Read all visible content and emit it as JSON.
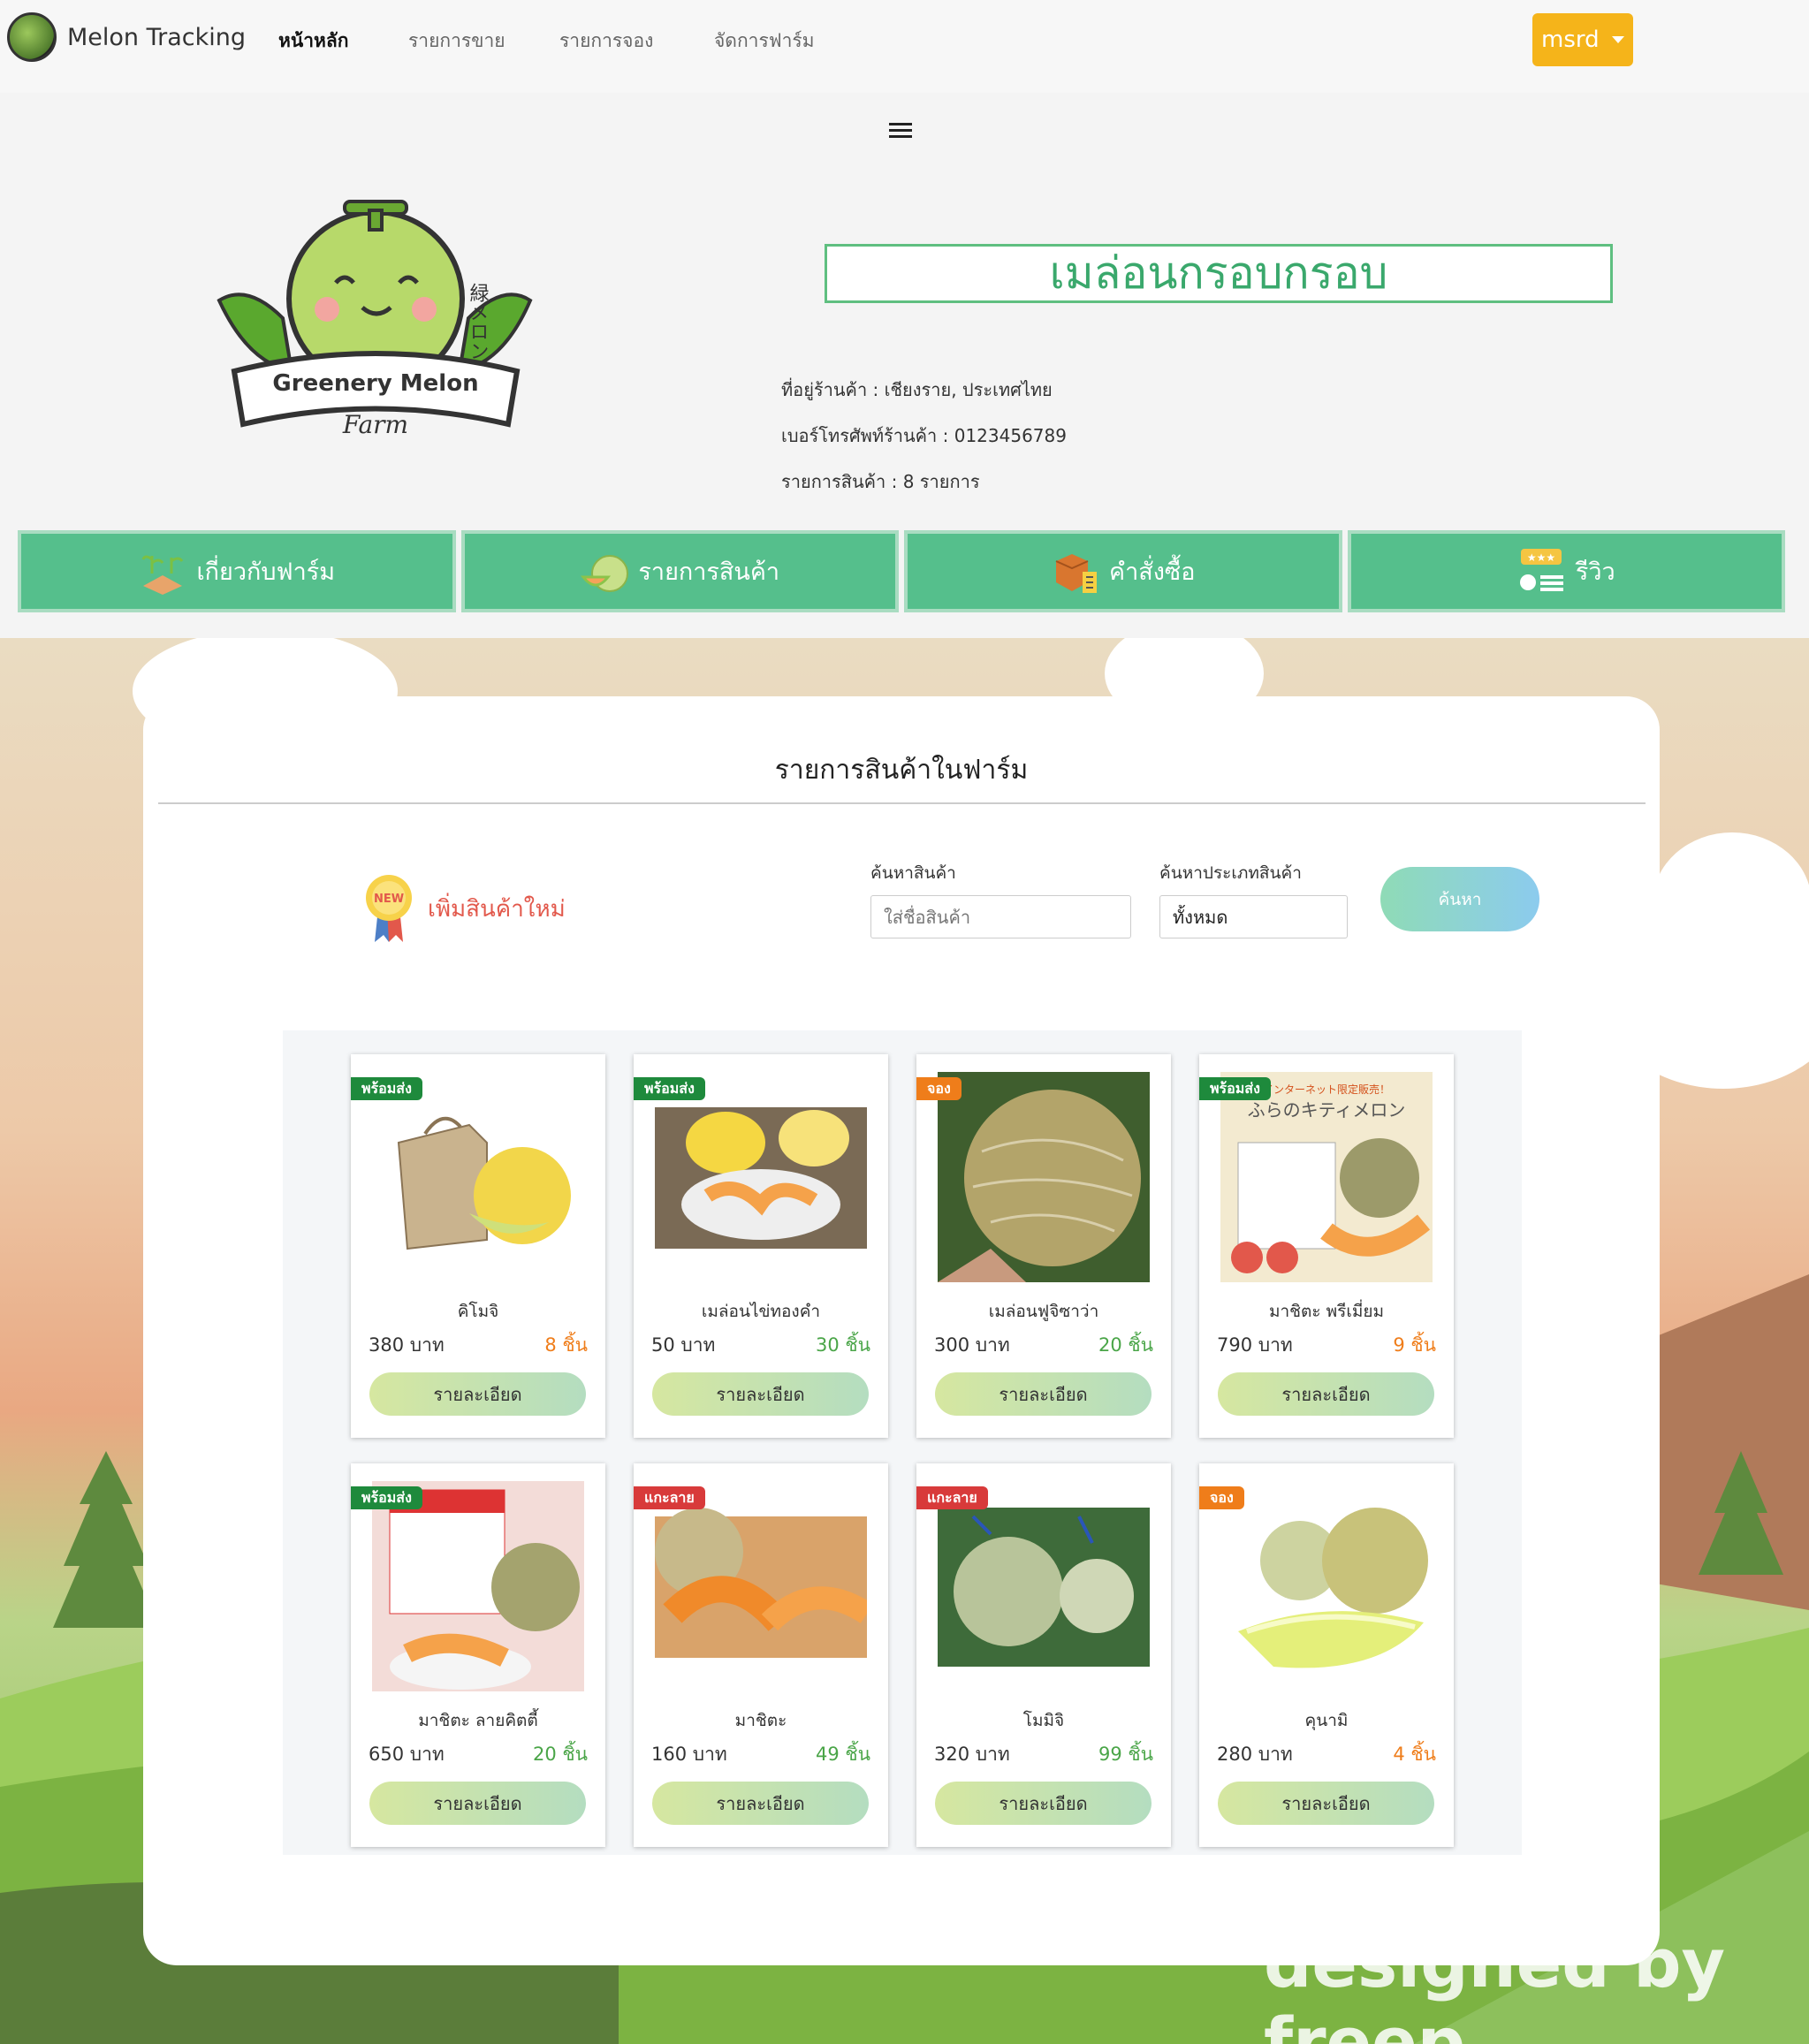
{
  "nav": {
    "brand": "Melon Tracking",
    "links": [
      "หน้าหลัก",
      "รายการขาย",
      "รายการจอง",
      "จัดการฟาร์ม"
    ],
    "user": "msrd"
  },
  "shop": {
    "logo_title": "Greenery Melon",
    "logo_sub": "Farm",
    "logo_jp": "緑メロン",
    "name": "เมล่อนกรอบกรอบ",
    "address": "ที่อยู่ร้านค้า : เชียงราย, ประเทศไทย",
    "phone": "เบอร์โทรศัพท์ร้านค้า : 0123456789",
    "count": "รายการสินค้า : 8 รายการ"
  },
  "tabs": [
    {
      "label": "เกี่ยวกับฟาร์ม",
      "icon": "farm-icon"
    },
    {
      "label": "รายการสินค้า",
      "icon": "melon-icon"
    },
    {
      "label": "คำสั่งซื้อ",
      "icon": "order-box-icon"
    },
    {
      "label": "รีวิว",
      "icon": "review-stars-icon"
    }
  ],
  "products_section": {
    "title": "รายการสินค้าในฟาร์ม",
    "new_badge": "NEW",
    "add_new": "เพิ่มสินค้าใหม่",
    "search_label": "ค้นหาสินค้า",
    "search_placeholder": "ใส่ชื่อสินค้า",
    "type_label": "ค้นหาประเภทสินค้า",
    "type_value": "ทั้งหมด",
    "search_button": "ค้นหา"
  },
  "products": [
    {
      "badge": "พร้อมส่ง",
      "name": "คิโมจิ",
      "price": "380 บาท",
      "stock": "8 ชิ้น",
      "detail": "รายละเอียด"
    },
    {
      "badge": "พร้อมส่ง",
      "name": "เมล่อนไข่ทองคำ",
      "price": "50 บาท",
      "stock": "30 ชิ้น",
      "detail": "รายละเอียด"
    },
    {
      "badge": "จอง",
      "name": "เมล่อนฟูจิซาว่า",
      "price": "300 บาท",
      "stock": "20 ชิ้น",
      "detail": "รายละเอียด"
    },
    {
      "badge": "พร้อมส่ง",
      "name": "มาชิตะ พรีเมี่ยม",
      "price": "790 บาท",
      "stock": "9 ชิ้น",
      "detail": "รายละเอียด"
    },
    {
      "badge": "พร้อมส่ง",
      "name": "มาชิตะ ลายคิตตี้",
      "price": "650 บาท",
      "stock": "20 ชิ้น",
      "detail": "รายละเอียด"
    },
    {
      "badge": "แกะลาย",
      "name": "มาชิตะ",
      "price": "160 บาท",
      "stock": "49 ชิ้น",
      "detail": "รายละเอียด"
    },
    {
      "badge": "แกะลาย",
      "name": "โมมิจิ",
      "price": "320 บาท",
      "stock": "99 ชิ้น",
      "detail": "รายละเอียด"
    },
    {
      "badge": "จอง",
      "name": "คุนามิ",
      "price": "280 บาท",
      "stock": "4 ชิ้น",
      "detail": "รายละเอียด"
    }
  ],
  "card_texts": {
    "product_4_header": "インターネット限定販売！",
    "product_4_title": "ふらのキティメロン"
  },
  "watermark": "designed by freep",
  "colors": {
    "accent_green": "#55bf8c",
    "title_green": "#3aa86c",
    "user_button": "#f5b41a",
    "badge_ready": "#1e8a3c",
    "badge_reserve": "#ef7d1a",
    "badge_carved": "#d83a3a",
    "stock_green": "#4aa548",
    "stock_orange": "#ef7d1a"
  }
}
